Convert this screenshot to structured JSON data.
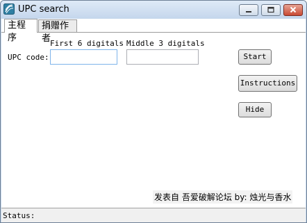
{
  "window": {
    "title": "UPC search",
    "icons": {
      "app": "app-icon",
      "minimize": "minimize-icon",
      "maximize": "maximize-icon",
      "close": "close-icon"
    }
  },
  "tabs": [
    {
      "label": "主程序",
      "active": true
    },
    {
      "label": "捐赠作者",
      "active": false
    }
  ],
  "form": {
    "upc_label": "UPC code:",
    "first_label": "First 6 digitals",
    "middle_label": "Middle 3 digitals",
    "first_value": "",
    "middle_value": ""
  },
  "buttons": {
    "start": "Start",
    "instructions": "Instructions",
    "hide": "Hide"
  },
  "footer": {
    "credit": "发表自 吾爱破解论坛 by: 烛光与香水"
  },
  "status": {
    "label": "Status:"
  },
  "colors": {
    "titlebar": "#c9dbef",
    "close_button": "#c94a34",
    "focus_border": "#7eb4ea"
  }
}
